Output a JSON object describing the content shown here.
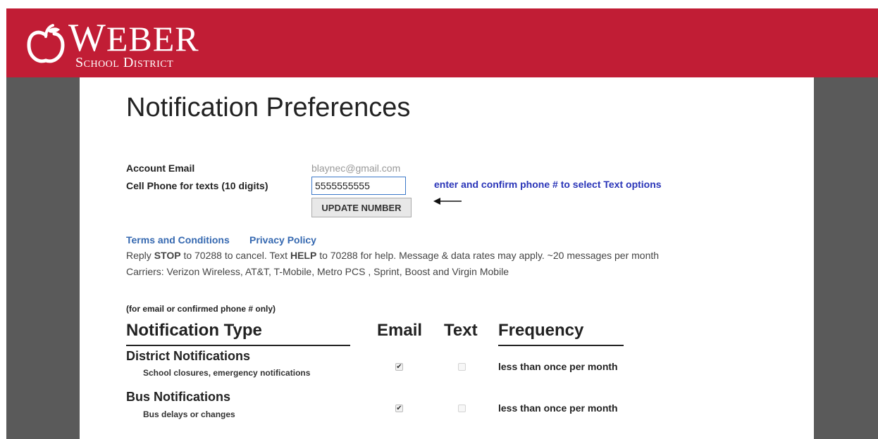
{
  "header": {
    "logo_word_initial": "W",
    "logo_word_rest": "EBER",
    "logo_sub": "School District",
    "brand_color": "#c11d35"
  },
  "page_title": "Notification Preferences",
  "account": {
    "email_label": "Account Email",
    "email_value": "blaynec@gmail.com",
    "phone_label": "Cell Phone for texts (10 digits)",
    "phone_value": "5555555555",
    "update_button_label": "UPDATE NUMBER",
    "hint": "enter and confirm phone # to select Text options"
  },
  "links": {
    "terms": "Terms and Conditions",
    "privacy": "Privacy Policy"
  },
  "info": {
    "reply_prefix": "Reply ",
    "stop": "STOP",
    "reply_mid": " to 70288 to cancel. Text ",
    "help": "HELP",
    "reply_suffix": " to 70288 for help. Message & data rates may apply. ~20 messages per month",
    "carriers": "Carriers: Verizon Wireless, AT&T, T-Mobile, Metro PCS , Sprint, Boost and Virgin Mobile"
  },
  "table": {
    "note": "(for email or confirmed phone # only)",
    "col_type": "Notification Type",
    "col_email": "Email",
    "col_text": "Text",
    "col_frequency": "Frequency",
    "rows": [
      {
        "title": "District Notifications",
        "subtitle": "School closures, emergency notifications",
        "email_checked": true,
        "text_checked": false,
        "frequency": "less than once per month"
      },
      {
        "title": "Bus Notifications",
        "subtitle": "Bus delays or changes",
        "email_checked": true,
        "text_checked": false,
        "frequency": "less than once per month"
      }
    ]
  }
}
